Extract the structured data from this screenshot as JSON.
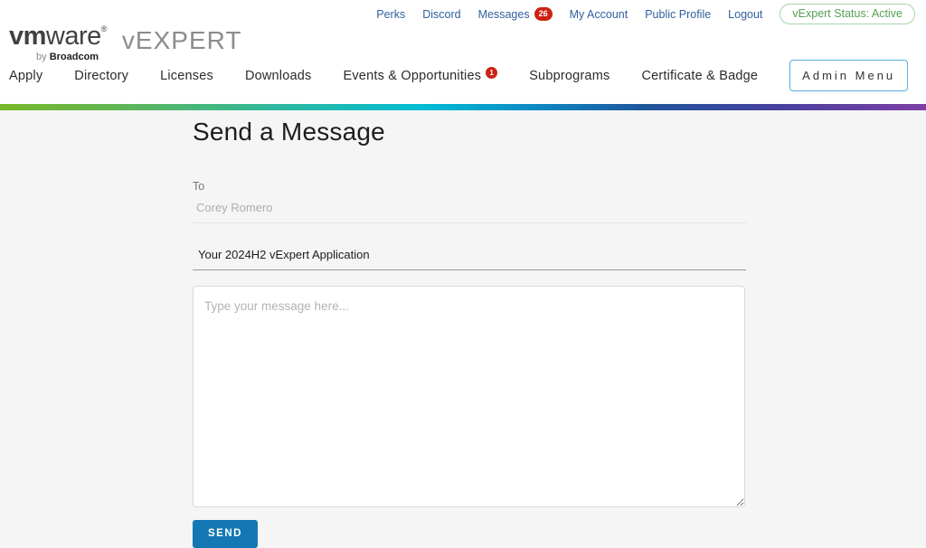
{
  "brand": {
    "logo_text_bold": "vm",
    "logo_text_rest": "ware",
    "logo_mark": "®",
    "byline_prefix": "by",
    "byline_name": "Broadcom",
    "product_name": "vEXPERT"
  },
  "utility_nav": {
    "items": [
      "Perks",
      "Discord",
      "Messages",
      "My Account",
      "Public Profile",
      "Logout"
    ],
    "messages_badge": "26",
    "status_pill": "vExpert Status: Active"
  },
  "main_nav": {
    "items": [
      "Apply",
      "Directory",
      "Licenses",
      "Downloads",
      "Events & Opportunities",
      "Subprograms",
      "Certificate & Badge"
    ],
    "events_badge": "1",
    "admin_button": "Admin Menu"
  },
  "page": {
    "title": "Send a Message"
  },
  "form": {
    "to_label": "To",
    "to_value": "Corey Romero",
    "subject_value": "Your 2024H2 vExpert Application",
    "message_placeholder": "Type your message here...",
    "send_label": "SEND"
  },
  "colors": {
    "link_blue": "#31609f",
    "nav_text": "#2b2b2b",
    "badge_red": "#cc2314",
    "status_green": "#55a155",
    "status_border_green": "#a9d3a9",
    "send_blue": "#1478b5",
    "admin_border_blue": "#57ade0",
    "content_bg": "#f5f5f5",
    "gradient": [
      "#78b829",
      "#00bcd4",
      "#1f5499",
      "#7d3fa5"
    ]
  }
}
